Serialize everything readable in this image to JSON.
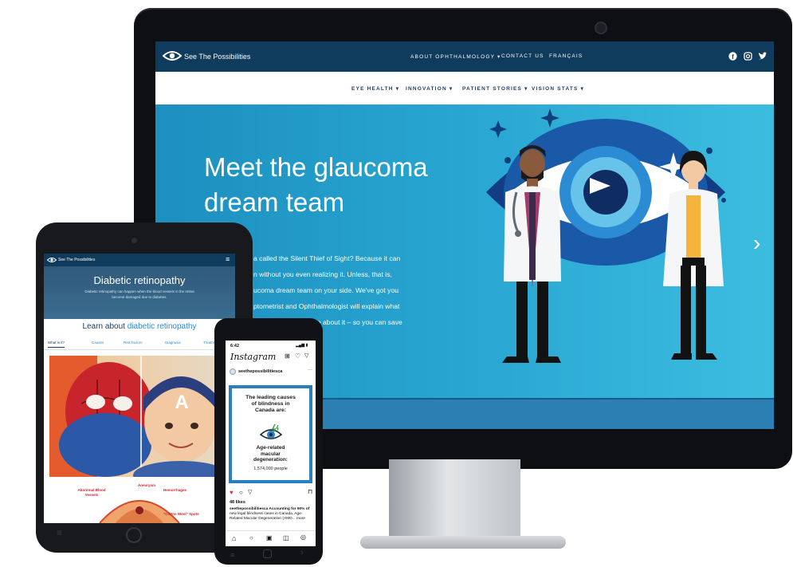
{
  "desktop": {
    "brand": "See The Possibilities",
    "top_nav": [
      "ABOUT OPHTHALMOLOGY",
      "CONTACT US",
      "FRANÇAIS"
    ],
    "main_nav": [
      "EYE HEALTH",
      "INNOVATION",
      "PATIENT STORIES",
      "VISION STATS"
    ],
    "hero_title_line1": "Meet the glaucoma",
    "hero_title_line2": "dream team",
    "hero_lines": [
      "a called the Silent Thief of Sight? Because it can",
      "n without you even realizing it. Unless, that is,",
      "ucoma dream team on your side. We've got you",
      "ptometrist and Ophthalmologist will explain what",
      "d what you need to do about it – so you can save"
    ],
    "next_arrow": "›",
    "social_icons": [
      "facebook-icon",
      "instagram-icon",
      "twitter-icon"
    ]
  },
  "tablet": {
    "brand": "See The Possibilities",
    "hero_title": "Diabetic retinopathy",
    "hero_sub_line1": "Diabetic retinopathy can happen when the blood vessels in the retina",
    "hero_sub_line2": "become damaged due to diabetes.",
    "learn_prefix": "Learn about",
    "learn_highlight": "diabetic retinopathy",
    "tabs": [
      "What is it?",
      "Causes",
      "Risk factors",
      "Diagnosis",
      "Treatm"
    ],
    "diagram_labels": [
      "Abnormal Blood Vessels",
      "Aneurysm",
      "Hemorrhages",
      "\"Cotton Wool\" Spots"
    ]
  },
  "phone": {
    "time": "6:42",
    "app": "Instagram",
    "account": "seethepossibilitiesca",
    "post_title_lines": [
      "The leading causes",
      "of blindness in",
      "Canada are:"
    ],
    "post_condition_lines": [
      "Age-related",
      "macular",
      "degeneration:"
    ],
    "post_count": "1,574,000 people",
    "likes": "48 likes",
    "caption_lines": [
      "seethepossibilitiesca Accounting for 90% of",
      "new legal blindness cases in Canada, Age-",
      "Related Macular Degeneration (AMD... more"
    ]
  },
  "colors": {
    "navy": "#0f3b5c",
    "hero_blue": "#2aa6cf",
    "tablet_link": "#2a8ad1",
    "ig_border": "#2a7fbf"
  }
}
